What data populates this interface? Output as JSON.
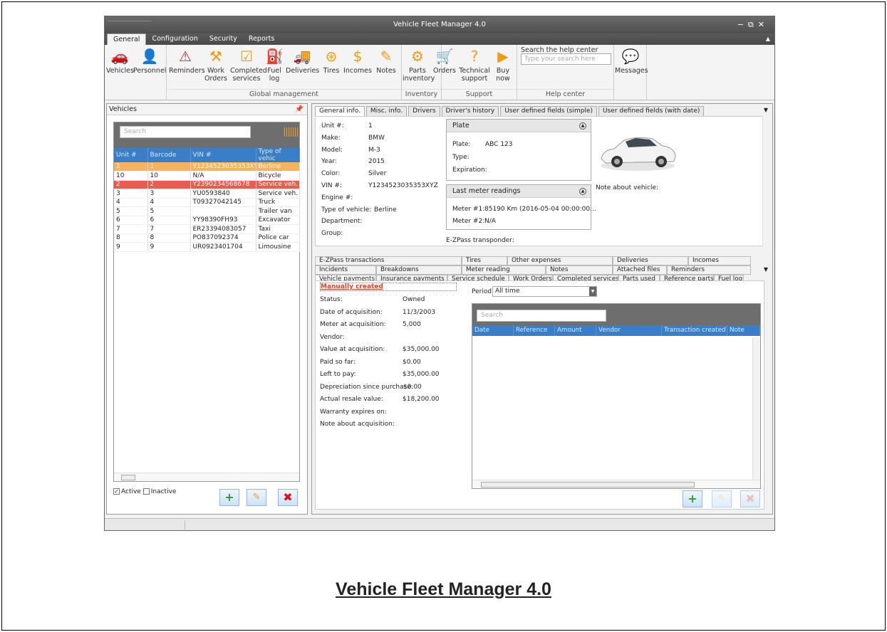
{
  "window": {
    "title": "Vehicle Fleet Manager 4.0",
    "controls": [
      "−",
      "⧉",
      "✕"
    ]
  },
  "menu": [
    "General",
    "Configuration",
    "Security",
    "Reports"
  ],
  "ribbon": {
    "buttons": [
      {
        "line1": "Vehicles",
        "line2": "",
        "icon": "car-icon"
      },
      {
        "line1": "Personnel",
        "line2": "",
        "icon": "person-icon"
      },
      {
        "line1": "Reminders",
        "line2": "",
        "icon": "warning-icon"
      },
      {
        "line1": "Work",
        "line2": "Orders",
        "icon": "worker-icon"
      },
      {
        "line1": "Completed",
        "line2": "services",
        "icon": "check-icon"
      },
      {
        "line1": "Fuel",
        "line2": "log",
        "icon": "fuel-icon"
      },
      {
        "line1": "Deliveries",
        "line2": "",
        "icon": "truck-icon"
      },
      {
        "line1": "Tires",
        "line2": "",
        "icon": "tire-icon"
      },
      {
        "line1": "Incomes",
        "line2": "",
        "icon": "money-icon"
      },
      {
        "line1": "Notes",
        "line2": "",
        "icon": "note-icon"
      },
      {
        "line1": "Parts",
        "line2": "inventory",
        "icon": "gears-icon"
      },
      {
        "line1": "Orders",
        "line2": "",
        "icon": "cart-icon"
      },
      {
        "line1": "Technical",
        "line2": "support",
        "icon": "question-icon"
      },
      {
        "line1": "Buy",
        "line2": "now",
        "icon": "buy-icon"
      },
      {
        "line1": "Messages",
        "line2": "",
        "icon": "chat-icon"
      }
    ],
    "groups": {
      "global": "Global management",
      "inventory": "Inventory",
      "support": "Support",
      "help": "Help center"
    },
    "help_title": "Search the help center",
    "help_placeholder": "Type your search here"
  },
  "vehicles_panel": {
    "title": "Vehicles",
    "search_placeholder": "Search",
    "columns": [
      "Unit #",
      "Barcode",
      "VIN #",
      "Type of vehic"
    ],
    "rows": [
      {
        "unit": "1",
        "barcode": "1",
        "vin": "Y1234523035353XYZ",
        "type": "Berline",
        "style": "orange"
      },
      {
        "unit": "10",
        "barcode": "10",
        "vin": "N/A",
        "type": "Bicycle",
        "style": ""
      },
      {
        "unit": "2",
        "barcode": "2",
        "vin": "Y2390234568678",
        "type": "Service veh.",
        "style": "red"
      },
      {
        "unit": "3",
        "barcode": "3",
        "vin": "YU0593840",
        "type": "Service veh.",
        "style": ""
      },
      {
        "unit": "4",
        "barcode": "4",
        "vin": "T09327042145",
        "type": "Truck",
        "style": ""
      },
      {
        "unit": "5",
        "barcode": "5",
        "vin": "",
        "type": "Trailer van",
        "style": ""
      },
      {
        "unit": "6",
        "barcode": "6",
        "vin": "YY98390FH93",
        "type": "Excavator",
        "style": ""
      },
      {
        "unit": "7",
        "barcode": "7",
        "vin": "ER23394083057",
        "type": "Taxi",
        "style": ""
      },
      {
        "unit": "8",
        "barcode": "8",
        "vin": "PO837092374",
        "type": "Police car",
        "style": ""
      },
      {
        "unit": "9",
        "barcode": "9",
        "vin": "UR0923401704",
        "type": "Limousine",
        "style": ""
      }
    ],
    "active_label": "Active",
    "inactive_label": "Inactive",
    "active_checked": true,
    "inactive_checked": false
  },
  "detail_tabs": [
    "General info.",
    "Misc. info.",
    "Drivers",
    "Driver's history",
    "User defined fields (simple)",
    "User defined fields (with date)"
  ],
  "general_info": {
    "fields": [
      {
        "label": "Unit #:",
        "value": "1"
      },
      {
        "label": "Make:",
        "value": "BMW"
      },
      {
        "label": "Model:",
        "value": "M-3"
      },
      {
        "label": "Year:",
        "value": "2015"
      },
      {
        "label": "Color:",
        "value": "Silver"
      },
      {
        "label": "VIN #:",
        "value": "Y1234523035353XYZ"
      },
      {
        "label": "Engine #:",
        "value": ""
      },
      {
        "label": "Type of vehicle:",
        "value": "Berline"
      },
      {
        "label": "Department:",
        "value": ""
      },
      {
        "label": "Group:",
        "value": ""
      }
    ],
    "plate_card": {
      "title": "Plate",
      "plate_label": "Plate:",
      "plate_value": "ABC 123",
      "type_label": "Type:",
      "expiration_label": "Expiration:"
    },
    "meter_card": {
      "title": "Last meter readings",
      "m1_label": "Meter #1:",
      "m1_value": "85190 Km (2016-05-04 00:00:00...",
      "m2_label": "Meter #2:",
      "m2_value": "N/A"
    },
    "ezpass_label": "E-ZPass transponder:",
    "note_label": "Note about vehicle:"
  },
  "sub_tabs": {
    "row1": [
      "E-ZPass transactions",
      "Tires",
      "Other expenses",
      "Deliveries",
      "Incomes"
    ],
    "row2": [
      "Incidents",
      "Breakdowns",
      "Meter reading",
      "Notes",
      "Attached files",
      "Reminders"
    ],
    "row3": [
      "Vehicle payments",
      "Insurance payments",
      "Service schedule",
      "Work Orders",
      "Completed services",
      "Parts used",
      "Reference parts",
      "Fuel log"
    ]
  },
  "payments": {
    "header": "Manually created",
    "fields": [
      {
        "label": "Status:",
        "value": "Owned"
      },
      {
        "label": "Date of acquisition:",
        "value": "11/3/2003"
      },
      {
        "label": "Meter at acquisition:",
        "value": "5,000"
      },
      {
        "label": "Vendor:",
        "value": ""
      },
      {
        "label": "Value at acquisition:",
        "value": "$35,000.00"
      },
      {
        "label": "Paid so far:",
        "value": "$0.00"
      },
      {
        "label": "Left to pay:",
        "value": "$35,000.00"
      },
      {
        "label": "Depreciation since purchase:",
        "value": "$0.00"
      },
      {
        "label": "Actual resale value:",
        "value": "$18,200.00"
      },
      {
        "label": "Warranty expires on:",
        "value": ""
      },
      {
        "label": "Note about acquisition:",
        "value": ""
      }
    ],
    "period_label": "Period:",
    "period_value": "All time",
    "search_placeholder": "Search",
    "columns": [
      "Date",
      "Reference",
      "Amount",
      "Vendor",
      "Transaction created",
      "Note"
    ]
  },
  "caption": "Vehicle Fleet Manager 4.0",
  "colors": {
    "accent": "#3a7ec8",
    "orange": "#f19a12",
    "selected_orange": "#f6b35c",
    "selected_red": "#e95d4f"
  }
}
